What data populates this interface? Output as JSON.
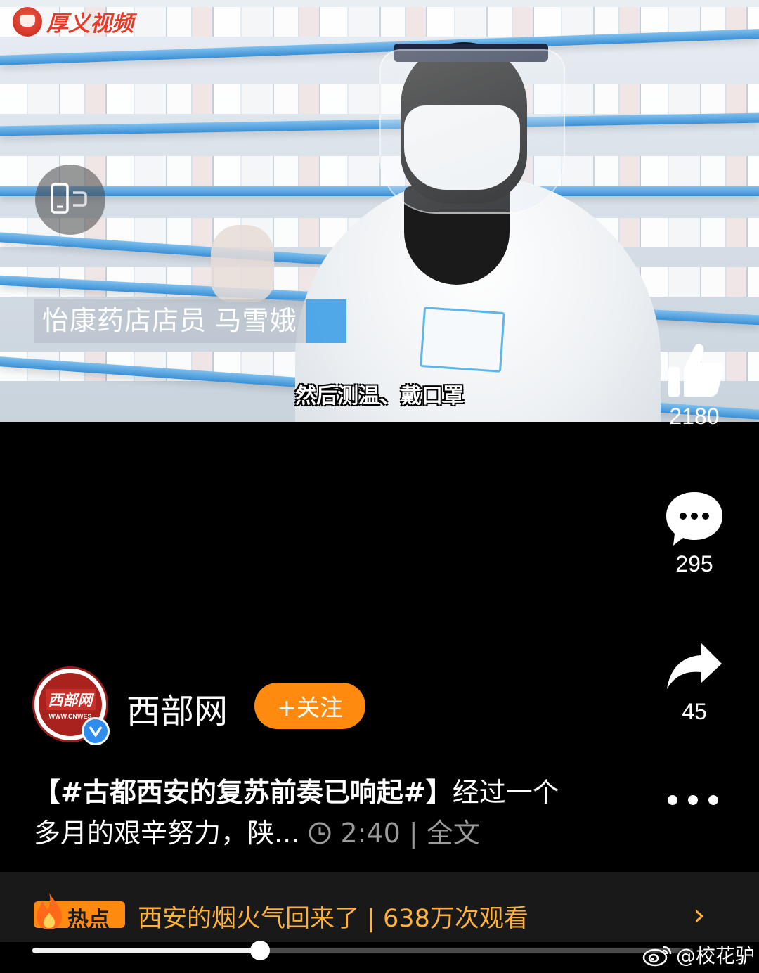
{
  "video": {
    "channel_logo": "厚义视频",
    "lower_third": "怡康药店店员 马雪娥",
    "subtitle": "然后测温、戴口罩"
  },
  "actions": {
    "likes": "2180",
    "comments": "295",
    "shares": "45"
  },
  "author": {
    "avatar_text": "西部网",
    "avatar_subtext": "WWW.CNWES",
    "name": "西部网",
    "follow_label": "+关注"
  },
  "caption": {
    "hashtag": "【#古都西安的复苏前奏已响起#】",
    "text": "经过一个多月的艰辛努力，陕...",
    "duration": "2:40",
    "separator": "|",
    "full_text_link": "全文"
  },
  "hot": {
    "badge": "热点",
    "text": "西安的烟火气回来了 | 638万次观看",
    "arrow": "›"
  },
  "playback": {
    "progress": 0.345
  },
  "watermark": {
    "text": "@校花驴"
  },
  "colors": {
    "accent_orange": "#ff8a10",
    "hot_text": "#ffb23b",
    "verified_blue": "#2f8df0",
    "background": "#000000"
  },
  "icons": [
    "rotate-screen-icon",
    "thumbs-up-icon",
    "comment-icon",
    "share-icon",
    "more-icon",
    "flame-icon",
    "clock-icon",
    "verified-icon",
    "weibo-icon",
    "chevron-right-icon"
  ]
}
